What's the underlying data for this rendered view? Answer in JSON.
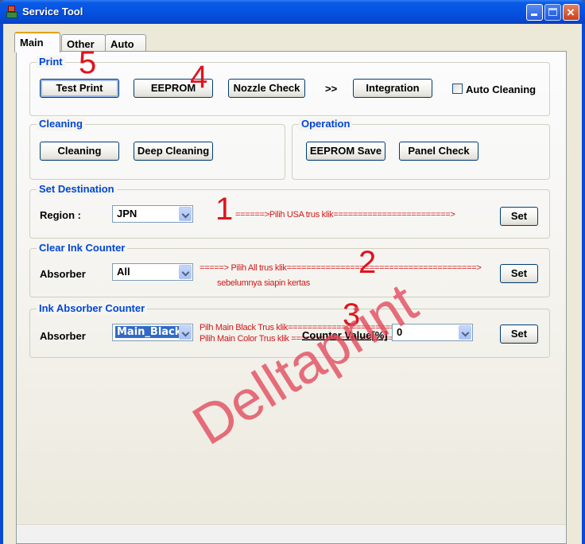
{
  "window": {
    "title": "Service Tool",
    "controls": {
      "minimize": "minimize",
      "maximize": "maximize",
      "close": "×"
    }
  },
  "tabs": [
    {
      "label": "Main",
      "active": true
    },
    {
      "label": "Other",
      "active": false
    },
    {
      "label": "Auto",
      "active": false
    }
  ],
  "print_group": {
    "label": "Print",
    "buttons": {
      "test_print": "Test Print",
      "eeprom": "EEPROM",
      "nozzle_check": "Nozzle Check",
      "integration": "Integration"
    },
    "separator": ">>",
    "auto_cleaning": {
      "label": "Auto Cleaning",
      "checked": false
    }
  },
  "cleaning_group": {
    "label": "Cleaning",
    "buttons": {
      "cleaning": "Cleaning",
      "deep_cleaning": "Deep Cleaning"
    }
  },
  "operation_group": {
    "label": "Operation",
    "buttons": {
      "eeprom_save": "EEPROM Save",
      "panel_check": "Panel Check"
    }
  },
  "set_destination": {
    "label": "Set Destination",
    "region_label": "Region :",
    "region_value": "JPN",
    "set_button": "Set",
    "annotation": "======>Pilih USA trus klik========================>"
  },
  "clear_ink_counter": {
    "label": "Clear Ink Counter",
    "absorber_label": "Absorber",
    "absorber_value": "All",
    "set_button": "Set",
    "annotation_line1": "=====> Pilih All  trus klik=======================================>",
    "annotation_line2": "sebelumnya siapin kertas"
  },
  "ink_absorber_counter": {
    "label": "Ink Absorber Counter",
    "absorber_label": "Absorber",
    "absorber_value": "Main_Black",
    "counter_value_label": "Counter Value[%]",
    "counter_value": "0",
    "set_button": "Set",
    "annotation_line1": "Pilh Main Black Trus klik=================================>",
    "annotation_line2": "Pilih Main Color Trus klik ===============================>"
  },
  "step_markers": {
    "step1": "1",
    "step2": "2",
    "step3": "3",
    "step4": "4",
    "step5": "5"
  },
  "watermark": "Delltaprint"
}
